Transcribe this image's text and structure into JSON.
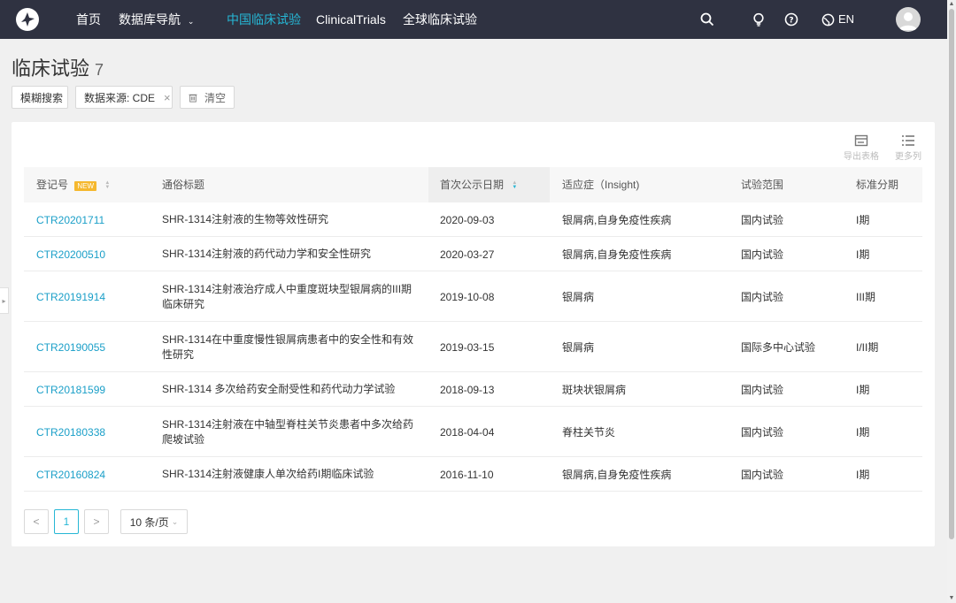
{
  "nav": {
    "items": [
      {
        "label": "首页",
        "active": false
      },
      {
        "label": "数据库导航",
        "active": false
      },
      {
        "label": "中国临床试验",
        "active": true
      },
      {
        "label": "ClinicalTrials",
        "active": false
      },
      {
        "label": "全球临床试验",
        "active": false
      }
    ],
    "lang_label": "EN",
    "accent_color": "#26b7d5"
  },
  "page": {
    "title": "临床试验",
    "count": "7"
  },
  "filters": {
    "fuzzy_search_label": "模糊搜索",
    "source_tag_label": "数据来源: CDE",
    "clear_label": "清空"
  },
  "toolbar": {
    "export_label": "导出表格",
    "more_columns_label": "更多列"
  },
  "table": {
    "headers": [
      "登记号",
      "通俗标题",
      "首次公示日期",
      "适应症（Insight)",
      "试验范围",
      "标准分期"
    ],
    "new_badge": "NEW",
    "rows": [
      {
        "id": "CTR20201711",
        "title_lines": [
          "SHR-1314注射液的生物等效性研究"
        ],
        "date": "2020-09-03",
        "indication": "银屑病,自身免疫性疾病",
        "scope": "国内试验",
        "phase": "I期"
      },
      {
        "id": "CTR20200510",
        "title_lines": [
          "SHR-1314注射液的药代动力学和安全性研究"
        ],
        "date": "2020-03-27",
        "indication": "银屑病,自身免疫性疾病",
        "scope": "国内试验",
        "phase": "I期"
      },
      {
        "id": "CTR20191914",
        "title_lines": [
          "SHR-1314注射液治疗成人中重度斑块型银屑病的III期",
          "临床研究"
        ],
        "date": "2019-10-08",
        "indication": "银屑病",
        "scope": "国内试验",
        "phase": "III期"
      },
      {
        "id": "CTR20190055",
        "title_lines": [
          "SHR-1314在中重度慢性银屑病患者中的安全性和有效",
          "性研究"
        ],
        "date": "2019-03-15",
        "indication": "银屑病",
        "scope": "国际多中心试验",
        "phase": "I/II期"
      },
      {
        "id": "CTR20181599",
        "title_lines": [
          "SHR-1314 多次给药安全耐受性和药代动力学试验"
        ],
        "date": "2018-09-13",
        "indication": "斑块状银屑病",
        "scope": "国内试验",
        "phase": "I期"
      },
      {
        "id": "CTR20180338",
        "title_lines": [
          "SHR-1314注射液在中轴型脊柱关节炎患者中多次给药",
          "爬坡试验"
        ],
        "date": "2018-04-04",
        "indication": "脊柱关节炎",
        "scope": "国内试验",
        "phase": "I期"
      },
      {
        "id": "CTR20160824",
        "title_lines": [
          "SHR-1314注射液健康人单次给药I期临床试验"
        ],
        "date": "2016-11-10",
        "indication": "银屑病,自身免疫性疾病",
        "scope": "国内试验",
        "phase": "I期"
      }
    ]
  },
  "pagination": {
    "prev": "<",
    "current": "1",
    "next": ">",
    "page_size": "10 条/页"
  }
}
